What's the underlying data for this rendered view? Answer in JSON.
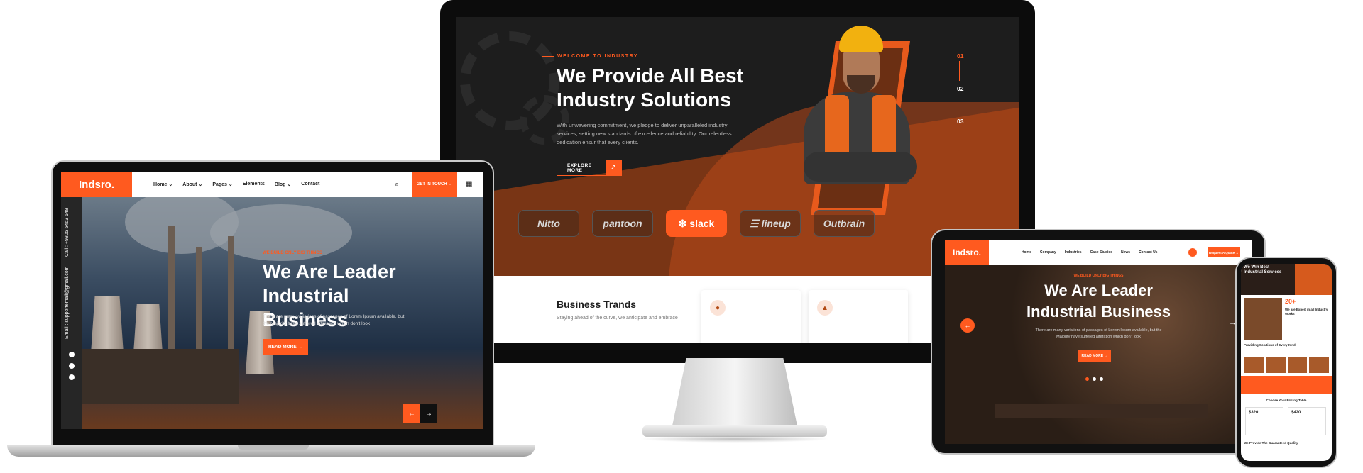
{
  "monitor": {
    "hero": {
      "subtitle": "WELCOME TO INDUSTRY",
      "title_line1": "We Provide All Best",
      "title_line2": "Industry Solutions",
      "description": "With unwavering commitment, we pledge to deliver unparalleled industry services, setting new standards of excellence and reliability. Our relentless dedication ensur that every clients.",
      "button_label": "EXPLORE MORE",
      "slides": [
        "01",
        "02",
        "03"
      ]
    },
    "brands": [
      "Nitto",
      "pantoon",
      "slack",
      "lineup",
      "Outbrain"
    ],
    "trends": {
      "title": "Business Trands",
      "description": "Staying ahead of the curve, we anticipate and embrace"
    }
  },
  "laptop": {
    "logo": "Indsro.",
    "nav": [
      "Home",
      "About",
      "Pages",
      "Elements",
      "Blog",
      "Contact"
    ],
    "cta": "GET IN TOUCH",
    "side_call": "Call : +9805 5463 548",
    "side_email": "Email : supportemail@gmail.com",
    "hero": {
      "tag": "WE BUILD ONLY BIG THINGS",
      "title_line1": "We Are Leader",
      "title_line2": "Industrial Business",
      "description": "There are many variations of passages of Lorem Ipsum available, but the Majority have suffered alteration which don't look",
      "button_label": "READ MORE"
    }
  },
  "tablet": {
    "logo": "Indsro.",
    "nav": [
      "Home",
      "Company",
      "Industries",
      "Case Studies",
      "News",
      "Contact Us"
    ],
    "cta": "Request A Quote",
    "hero": {
      "tag": "WE BUILD ONLY BIG THINGS",
      "title_line1": "We Are Leader",
      "title_line2": "Industrial Business",
      "description": "There are many variations of passages of Lorem Ipsum available, but the Majority have suffered alteration which don't look",
      "button_label": "READ MORE"
    }
  },
  "phone": {
    "hero_title": "We Win Best Industrial Services",
    "number": "20+",
    "sub1": "We are Expert in all Industry Works",
    "sec2": "Providing Solutions of Every Kind",
    "sec3": "Choose Your Pricing Table",
    "price1": "$320",
    "price2": "$420",
    "sec4": "We Provide The Guaranteed Quality"
  },
  "colors": {
    "accent": "#ff5a1f",
    "dark": "#1d1d1d"
  }
}
